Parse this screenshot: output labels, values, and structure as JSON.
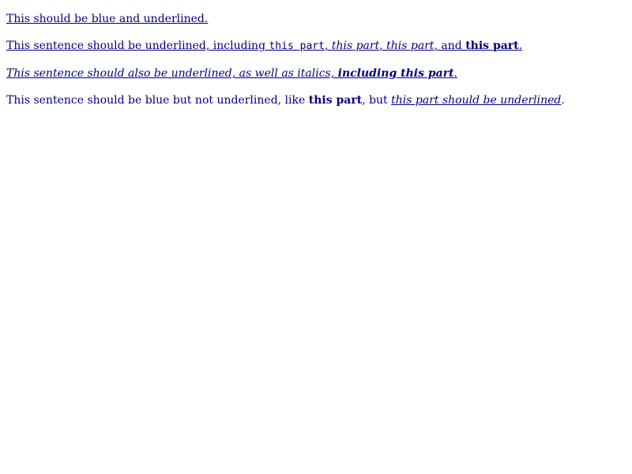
{
  "colors": {
    "text": "#000080",
    "background": "#ffffff"
  },
  "line1": {
    "text": "This should be blue and underlined."
  },
  "line2": {
    "a": "This sentence should be underlined, including ",
    "b_mono": "this part",
    "c": ", ",
    "d_italic": "this part",
    "e": ", ",
    "f_italic": "this part",
    "g": ", and ",
    "h_bold": "this part",
    "i": "."
  },
  "line3": {
    "a_italic": "This sentence should also be underlined, as well as italics, ",
    "b_bold_italic": "including this part",
    "c": "."
  },
  "line4": {
    "a": "This sentence should be blue but not underlined, like ",
    "b_bold": "this part",
    "c": ", but ",
    "d_italic_underlined": "this part should be underlined",
    "e": "."
  }
}
